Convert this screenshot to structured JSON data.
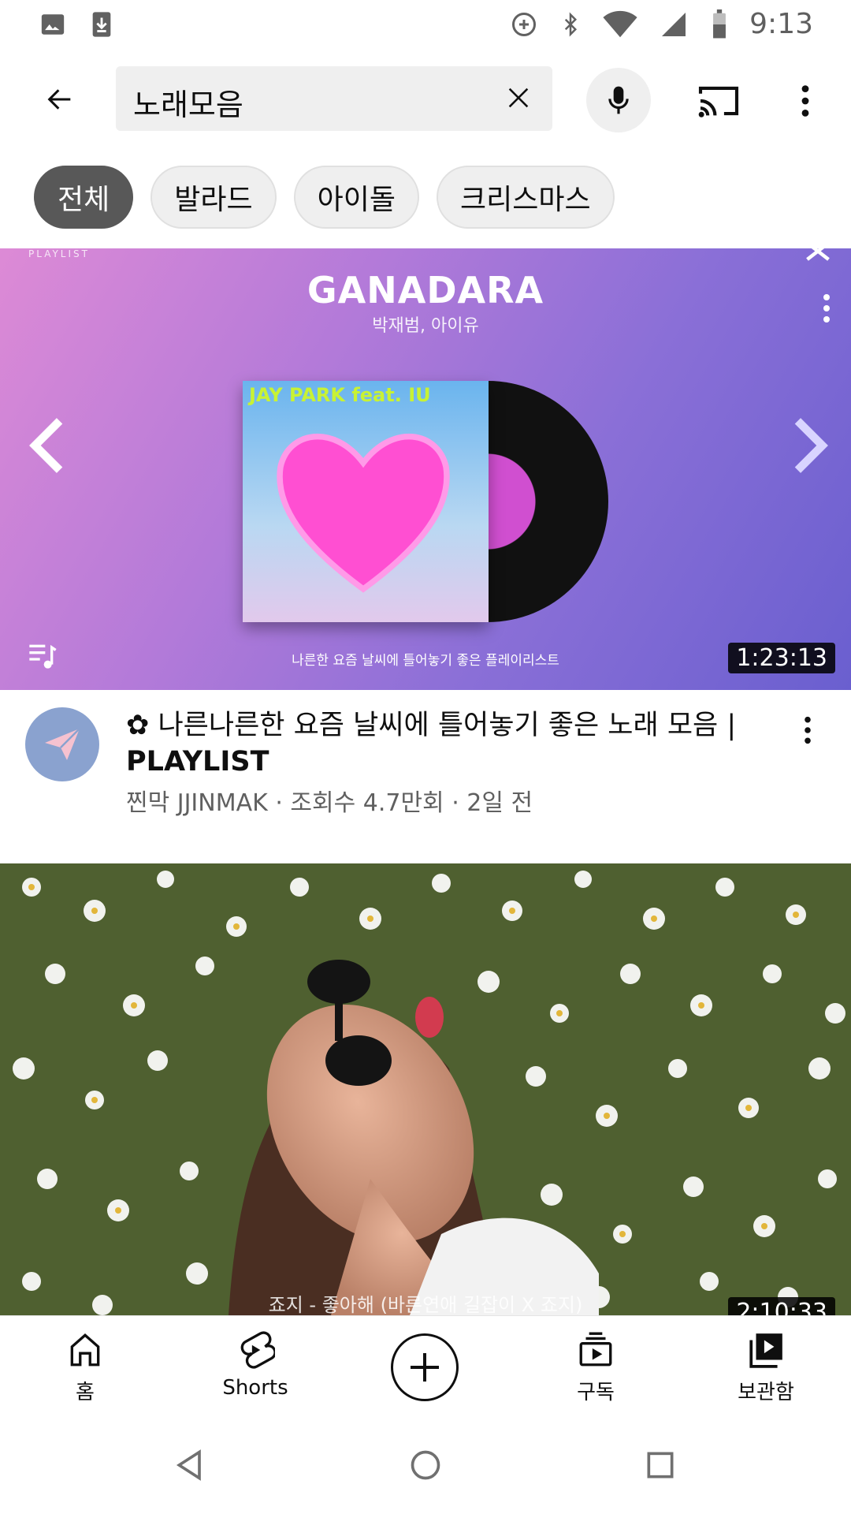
{
  "status_bar": {
    "time": "9:13"
  },
  "search": {
    "query": "노래모음"
  },
  "chips": [
    {
      "label": "전체",
      "active": true
    },
    {
      "label": "발라드",
      "active": false
    },
    {
      "label": "아이돌",
      "active": false
    },
    {
      "label": "크리스마스",
      "active": false
    }
  ],
  "video1": {
    "thumb_tag": "PLAYLIST",
    "thumb_title": "GANADARA",
    "thumb_subtitle": "박재범, 아이유",
    "album_text": "JAY PARK feat. IU",
    "thumb_tagline": "나른한 요즘 날씨에 틀어놓기 좋은 플레이리스트",
    "duration": "1:23:13",
    "title_main": "나른나른한 요즘 날씨에 틀어놓기 좋은 노래 모음 |",
    "title_bold": "PLAYLIST",
    "meta": "찐막 JJINMAK · 조회수 4.7만회 · 2일 전"
  },
  "video2": {
    "caption": "죠지 - 좋아해 (바른연애 길잡이 X 죠지)",
    "duration": "2:10:33"
  },
  "bottom_nav": {
    "home": "홈",
    "shorts": "Shorts",
    "subscriptions": "구독",
    "library": "보관함"
  }
}
